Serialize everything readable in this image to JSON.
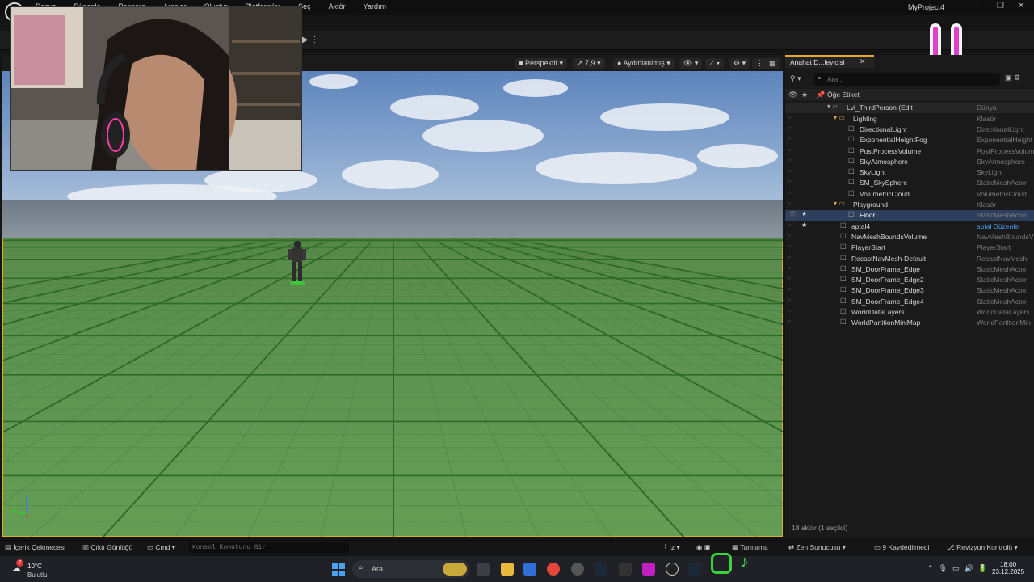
{
  "app": {
    "title": "MyProject4"
  },
  "menu": [
    "Dosya",
    "Düzenle",
    "Pencere",
    "Araçlar",
    "Oluştur",
    "Platformlar",
    "Seç",
    "Aktör",
    "Yardım"
  ],
  "viewport": {
    "perspective": "Perspektif",
    "speed": "7,9",
    "lit": "Aydınlatılmış"
  },
  "outliner": {
    "tab_label": "Anahat D...leyicisi",
    "search_placeholder": "Ara...",
    "header_label": "Öğe Etiketi",
    "level_row": {
      "name": "Lvl_ThirdPerson (Edit",
      "type": "Dünya"
    },
    "rows": [
      {
        "name": "Lighting",
        "type": "Klasör",
        "indent": 2,
        "icon": "folder-icon"
      },
      {
        "name": "DirectionalLight",
        "type": "DirectionalLight",
        "indent": 3,
        "icon": "sun-icon"
      },
      {
        "name": "ExponentialHeightFog",
        "type": "ExponentialHeight",
        "indent": 3,
        "icon": "fog-icon"
      },
      {
        "name": "PostProcessVolume",
        "type": "PostProcessVolum",
        "indent": 3,
        "icon": "volume-icon"
      },
      {
        "name": "SkyAtmosphere",
        "type": "SkyAtmosphere",
        "indent": 3,
        "icon": "atmosphere-icon"
      },
      {
        "name": "SkyLight",
        "type": "SkyLight",
        "indent": 3,
        "icon": "skylight-icon"
      },
      {
        "name": "SM_SkySphere",
        "type": "StaticMeshActor",
        "indent": 3,
        "icon": "mesh-icon"
      },
      {
        "name": "VolumetricCloud",
        "type": "VolumetricCloud",
        "indent": 3,
        "icon": "cloud-icon"
      },
      {
        "name": "Playground",
        "type": "Klasör",
        "indent": 2,
        "icon": "folder-icon"
      },
      {
        "name": "Floor",
        "type": "StaticMeshActor",
        "indent": 3,
        "icon": "mesh-icon",
        "selected": true
      },
      {
        "name": "aptal4",
        "type": "aptal Düzenle",
        "indent": 1,
        "icon": "pawn-icon",
        "link": true
      },
      {
        "name": "NavMeshBoundsVolume",
        "type": "NavMeshBoundsV",
        "indent": 1,
        "icon": "volume-icon"
      },
      {
        "name": "PlayerStart",
        "type": "PlayerStart",
        "indent": 1,
        "icon": "flag-icon"
      },
      {
        "name": "RecastNavMesh-Default",
        "type": "RecastNavMesh",
        "indent": 1,
        "icon": "navmesh-icon"
      },
      {
        "name": "SM_DoorFrame_Edge",
        "type": "StaticMeshActor",
        "indent": 1,
        "icon": "mesh-icon"
      },
      {
        "name": "SM_DoorFrame_Edge2",
        "type": "StaticMeshActor",
        "indent": 1,
        "icon": "mesh-icon"
      },
      {
        "name": "SM_DoorFrame_Edge3",
        "type": "StaticMeshActor",
        "indent": 1,
        "icon": "mesh-icon"
      },
      {
        "name": "SM_DoorFrame_Edge4",
        "type": "StaticMeshActor",
        "indent": 1,
        "icon": "mesh-icon"
      },
      {
        "name": "WorldDataLayers",
        "type": "WorldDataLayers",
        "indent": 1,
        "icon": "layers-icon"
      },
      {
        "name": "WorldPartitionMiniMap",
        "type": "WorldPartitionMin",
        "indent": 1,
        "icon": "map-icon"
      }
    ],
    "footer": "18 aktör (1 seçildi)"
  },
  "bottombar": {
    "content_drawer": "İçerik Çekmecesi",
    "output_log": "Çıktı Günlüğü",
    "cmd": "Cmd",
    "console_placeholder": "Konsol Komutunu Gir",
    "trace": "İz",
    "diagnostics": "Tanılama",
    "zen_server": "Zen Sunucusu",
    "unsaved": "9 Kaydedilmedi",
    "revision": "Revizyon Kontrolü"
  },
  "taskbar": {
    "weather_temp": "10°C",
    "weather_cond": "Bulutlu",
    "weather_badge": "7",
    "search_label": "Ara",
    "time": "18:00",
    "date": "23.12.2025"
  },
  "colors": {
    "accent": "#e8a530",
    "selection": "#2c3f5c",
    "smiley": "#e040c8",
    "floor": "#5d9350"
  }
}
